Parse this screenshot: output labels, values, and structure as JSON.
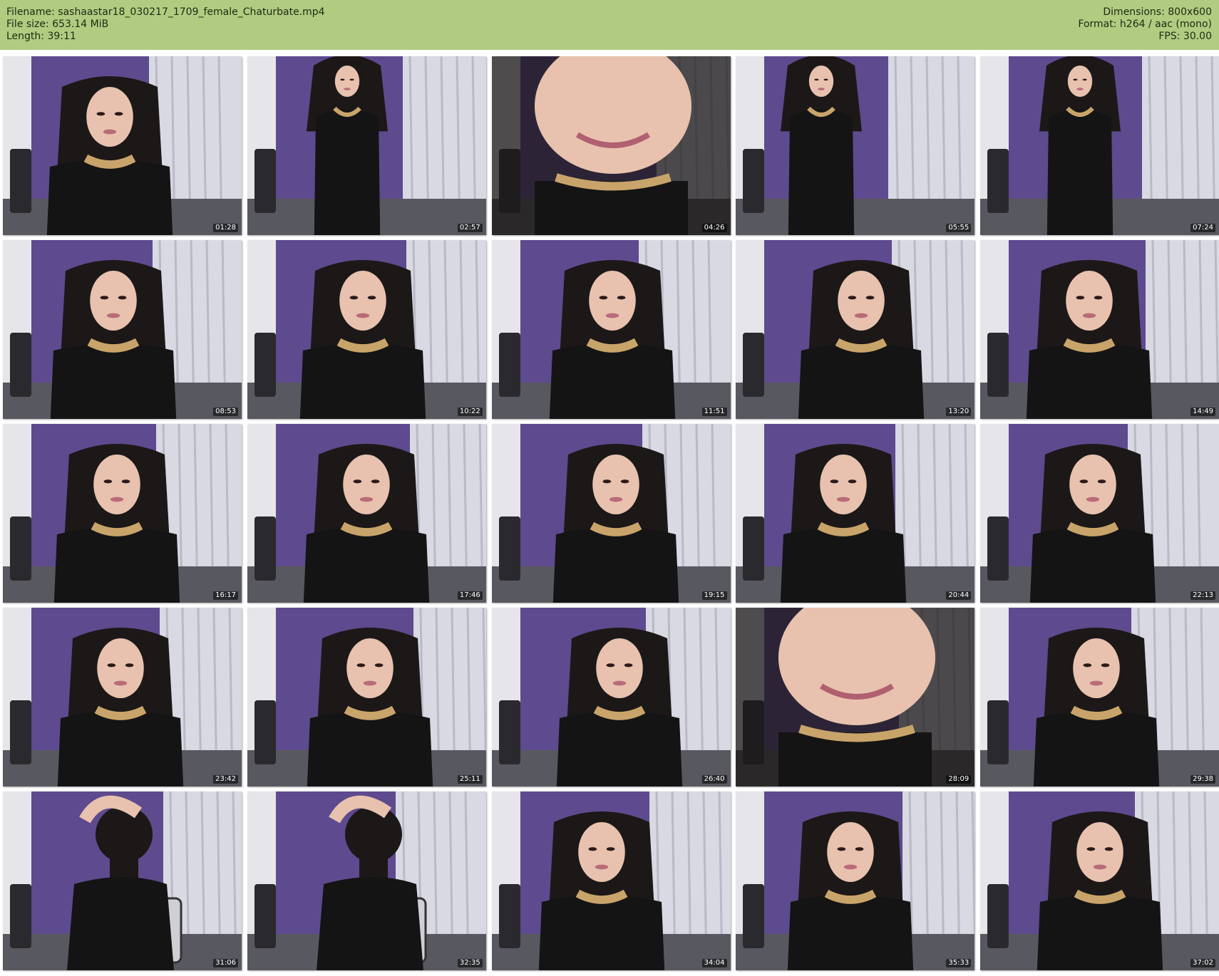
{
  "header": {
    "filename": "Filename: sashaastar18_030217_1709_female_Chaturbate.mp4",
    "filesize": "File size: 653.14 MiB",
    "length": "Length: 39:11",
    "dimensions": "Dimensions: 800x600",
    "format": "Format: h264 / aac (mono)",
    "fps": "FPS: 30.00"
  },
  "colors": {
    "header_bg": "#b0cc80",
    "wall_purple": "#5e4a8e",
    "curtain": "#d8d9e2",
    "top_black": "#141414",
    "hair": "#1c1818",
    "skin": "#e8c2ae",
    "necklace_gold": "#c9a46a",
    "floor": "#585960"
  },
  "thumbnails": [
    {
      "time": "01:28",
      "scene": "face-closeup"
    },
    {
      "time": "02:57",
      "scene": "standing"
    },
    {
      "time": "04:26",
      "scene": "extreme-closeup"
    },
    {
      "time": "05:55",
      "scene": "standing"
    },
    {
      "time": "07:24",
      "scene": "standing"
    },
    {
      "time": "08:53",
      "scene": "face-closeup"
    },
    {
      "time": "10:22",
      "scene": "seated"
    },
    {
      "time": "11:51",
      "scene": "seated"
    },
    {
      "time": "13:20",
      "scene": "seated"
    },
    {
      "time": "14:49",
      "scene": "seated"
    },
    {
      "time": "16:17",
      "scene": "seated"
    },
    {
      "time": "17:46",
      "scene": "seated"
    },
    {
      "time": "19:15",
      "scene": "leaning"
    },
    {
      "time": "20:44",
      "scene": "seated"
    },
    {
      "time": "22:13",
      "scene": "seated"
    },
    {
      "time": "23:42",
      "scene": "seated"
    },
    {
      "time": "25:11",
      "scene": "seated"
    },
    {
      "time": "26:40",
      "scene": "seated"
    },
    {
      "time": "28:09",
      "scene": "extreme-closeup"
    },
    {
      "time": "29:38",
      "scene": "seated"
    },
    {
      "time": "31:06",
      "scene": "back-view"
    },
    {
      "time": "32:35",
      "scene": "back-view"
    },
    {
      "time": "34:04",
      "scene": "seated"
    },
    {
      "time": "35:33",
      "scene": "face-closeup"
    },
    {
      "time": "37:02",
      "scene": "seated"
    }
  ]
}
